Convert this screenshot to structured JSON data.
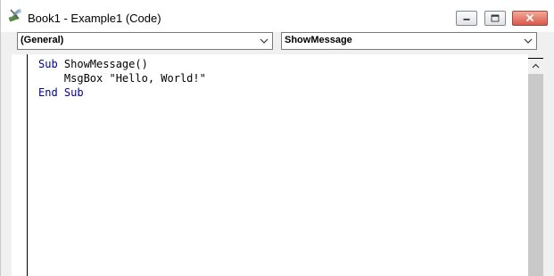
{
  "window": {
    "title": "Book1 - Example1 (Code)",
    "icon": "vba-project-icon",
    "buttons": {
      "minimize": "minimize-icon",
      "maximize": "maximize-icon",
      "close": "close-icon"
    },
    "close_color": "#d9584a"
  },
  "dropdowns": {
    "object": {
      "value": "(General)"
    },
    "procedure": {
      "value": "ShowMessage"
    }
  },
  "code": {
    "lines": [
      {
        "keyword": "Sub",
        "rest": " ShowMessage()"
      },
      {
        "indent": "    ",
        "text": "MsgBox \"Hello, World!\""
      },
      {
        "keyword1": "End",
        "space": " ",
        "keyword2": "Sub"
      }
    ],
    "keyword_color": "#00008b"
  }
}
